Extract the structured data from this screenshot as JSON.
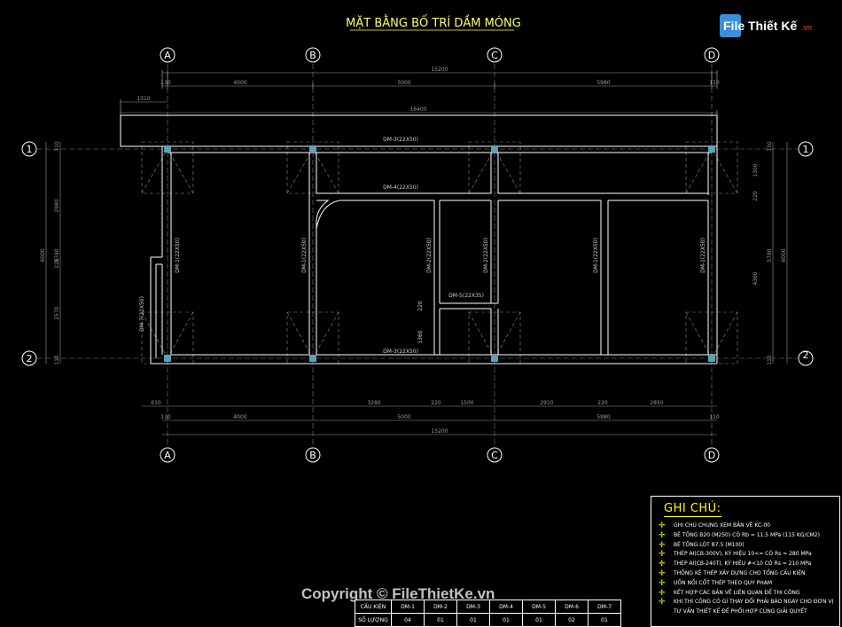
{
  "title": "MẶT BẰNG BỐ TRÍ DẦM MÓNG",
  "grid_letters": [
    "A",
    "B",
    "C",
    "D"
  ],
  "grid_numbers": [
    "1",
    "2"
  ],
  "dims_top": {
    "overall": "15200",
    "offset": "110",
    "spans": [
      "4000",
      "5000",
      "5980"
    ],
    "overhang": "1310",
    "cantilever_total": "16400"
  },
  "dims_bottom": {
    "lead": "610",
    "offset": "110",
    "segments": [
      "3280",
      "220",
      "1500",
      "2910",
      "220",
      "2850"
    ],
    "spans": [
      "4000",
      "5000",
      "5980"
    ],
    "overall": "15200"
  },
  "dims_left": {
    "overall": "6000",
    "parts": [
      "110",
      "2980",
      "5780",
      "220",
      "2570",
      "110"
    ]
  },
  "dims_right": {
    "overall": "6000",
    "parts": [
      "150",
      "1300",
      "220",
      "5780",
      "4360",
      "110"
    ]
  },
  "dims_inner": [
    "220",
    "1360"
  ],
  "beam_labels": {
    "top": "DM-3(22X50)",
    "mid": "DM-4(22X50)",
    "bottom": "DM-3(22X50)",
    "left_stub": "DM-7(22X50)",
    "short": "DM-5(22X35)",
    "v1": "DM-1(22X50)",
    "v2": "DM-1(22X50)",
    "v3": "DM-2(22X50)",
    "v4": "DM-2(22X50)",
    "v5": "DM-1(22X50)",
    "v6": "DM-1(22X50)"
  },
  "notes": {
    "title": "GHI CHÚ:",
    "items": [
      "GHI CHÚ CHUNG XEM BẢN VẼ KC-00",
      "BÊ TÔNG B20 (M250) CÓ Rb = 11.5 MPa (115 KG/CM2)",
      "BÊ TÔNG LÓT B7.5 (M100)",
      "THÉP AI(CB-300V), KÝ HIỆU 10<= CÓ Rs = 280 MPa",
      "THÉP AI(CB-240T), KÝ HIỆU #<10 CÓ Rs = 210 MPa",
      "THỐNG KÊ THÉP XÂY DỰNG CHO TỔNG CẤU KIỆN",
      "UỐN NỐI CỐT THÉP THEO QUY PHẠM",
      "KẾT HỢP CÁC BẢN VẼ LIÊN QUAN ĐỂ THI CÔNG",
      "KHI THI CÔNG CÓ GÌ THAY ĐỔI PHẢI BÁO NGAY CHO ĐƠN VỊ",
      "TƯ VẤN THIẾT KẾ ĐỂ PHỐI HỢP CÙNG GIẢI QUYẾT"
    ]
  },
  "table": {
    "row1": [
      "CẤU KIỆN",
      "DM-1",
      "DM-2",
      "DM-3",
      "DM-4",
      "DM-5",
      "DM-6",
      "DM-7"
    ],
    "row2": [
      "SỐ LƯỢNG",
      "04",
      "01",
      "01",
      "01",
      "01",
      "02",
      "01"
    ]
  },
  "watermark": "Copyright © FileThietKe.vn",
  "logo_text": "File Thiết Kế",
  "logo_suffix": ".vn",
  "colors": {
    "background": "#000000",
    "title": "#ffff66",
    "line": "#ffffff",
    "dim": "#9a9a9a",
    "label": "#7cfc00",
    "column": "#6fa8c0"
  }
}
